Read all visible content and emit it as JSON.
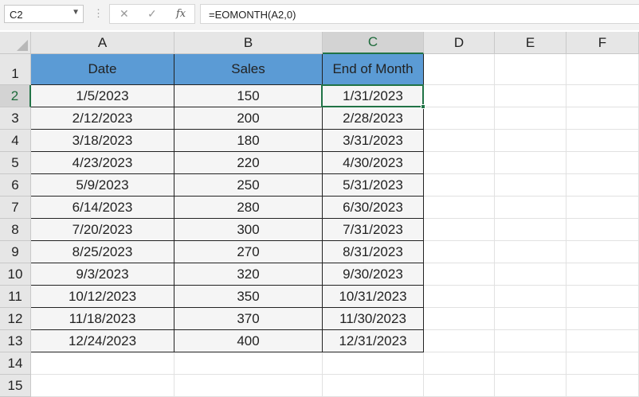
{
  "formula_bar": {
    "name_box": "C2",
    "cancel_icon": "✕",
    "enter_icon": "✓",
    "fx_label": "fx",
    "formula": "=EOMONTH(A2,0)"
  },
  "columns": [
    "A",
    "B",
    "C",
    "D",
    "E",
    "F"
  ],
  "selected_cell": "C2",
  "rows": [
    {
      "num": "1",
      "cells": [
        "Date",
        "Sales",
        "End of Month",
        "",
        "",
        ""
      ]
    },
    {
      "num": "2",
      "cells": [
        "1/5/2023",
        "150",
        "1/31/2023",
        "",
        "",
        ""
      ]
    },
    {
      "num": "3",
      "cells": [
        "2/12/2023",
        "200",
        "2/28/2023",
        "",
        "",
        ""
      ]
    },
    {
      "num": "4",
      "cells": [
        "3/18/2023",
        "180",
        "3/31/2023",
        "",
        "",
        ""
      ]
    },
    {
      "num": "5",
      "cells": [
        "4/23/2023",
        "220",
        "4/30/2023",
        "",
        "",
        ""
      ]
    },
    {
      "num": "6",
      "cells": [
        "5/9/2023",
        "250",
        "5/31/2023",
        "",
        "",
        ""
      ]
    },
    {
      "num": "7",
      "cells": [
        "6/14/2023",
        "280",
        "6/30/2023",
        "",
        "",
        ""
      ]
    },
    {
      "num": "8",
      "cells": [
        "7/20/2023",
        "300",
        "7/31/2023",
        "",
        "",
        ""
      ]
    },
    {
      "num": "9",
      "cells": [
        "8/25/2023",
        "270",
        "8/31/2023",
        "",
        "",
        ""
      ]
    },
    {
      "num": "10",
      "cells": [
        "9/3/2023",
        "320",
        "9/30/2023",
        "",
        "",
        ""
      ]
    },
    {
      "num": "11",
      "cells": [
        "10/12/2023",
        "350",
        "10/31/2023",
        "",
        "",
        ""
      ]
    },
    {
      "num": "12",
      "cells": [
        "11/18/2023",
        "370",
        "11/30/2023",
        "",
        "",
        ""
      ]
    },
    {
      "num": "13",
      "cells": [
        "12/24/2023",
        "400",
        "12/31/2023",
        "",
        "",
        ""
      ]
    },
    {
      "num": "14",
      "cells": [
        "",
        "",
        "",
        "",
        "",
        ""
      ]
    },
    {
      "num": "15",
      "cells": [
        "",
        "",
        "",
        "",
        "",
        ""
      ]
    }
  ],
  "colors": {
    "header_fill": "#5b9bd5",
    "selection": "#217346",
    "table_fill": "#f5f5f5"
  }
}
